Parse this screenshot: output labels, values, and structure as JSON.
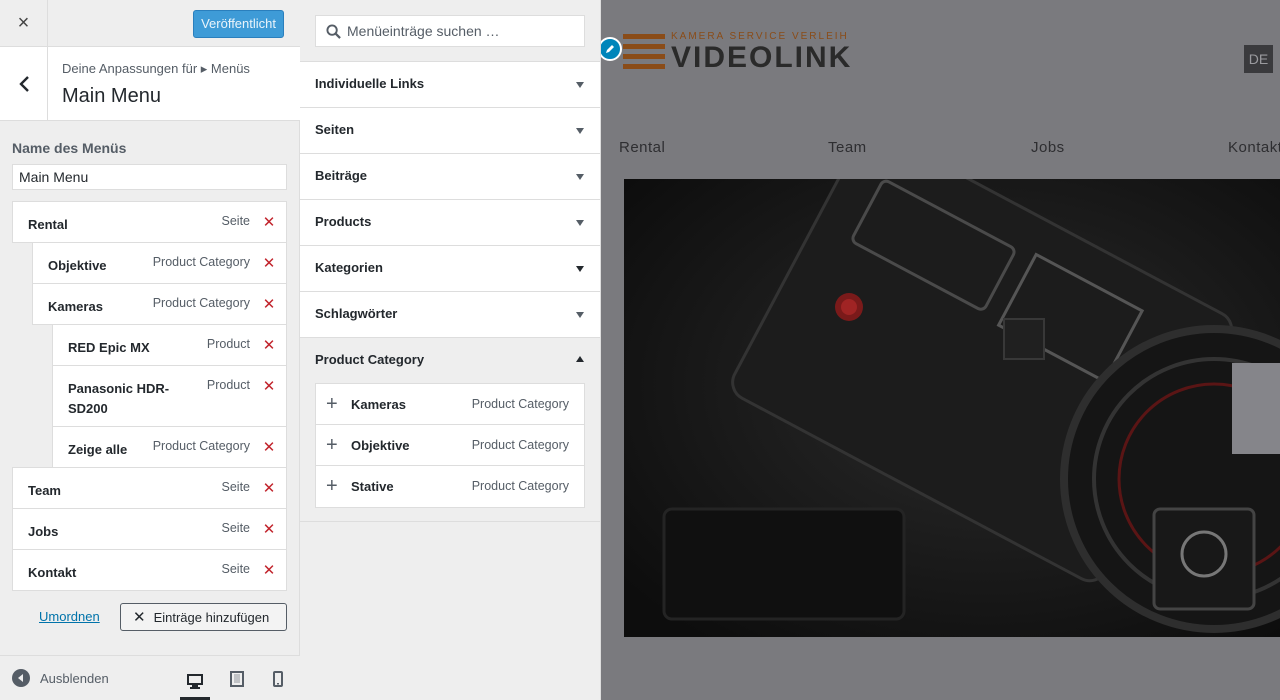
{
  "topbar": {
    "close_icon": "×",
    "publish_label": "Veröffentlicht",
    "publish_color": "#3e9bd7"
  },
  "section": {
    "crumb": "Deine Anpassungen für ▸ Menüs",
    "title": "Main Menu"
  },
  "menu_name": {
    "label": "Name des Menüs",
    "value": "Main Menu"
  },
  "menu_items": [
    {
      "title": "Rental",
      "type": "Seite"
    },
    {
      "title": "Objektive",
      "type": "Product Category"
    },
    {
      "title": "Kameras",
      "type": "Product Category"
    },
    {
      "title": "RED Epic MX",
      "type": "Product"
    },
    {
      "title": "Panasonic HDR-SD200",
      "type": "Product"
    },
    {
      "title": "Zeige alle",
      "type": "Product Category"
    },
    {
      "title": "Team",
      "type": "Seite"
    },
    {
      "title": "Jobs",
      "type": "Seite"
    },
    {
      "title": "Kontakt",
      "type": "Seite"
    }
  ],
  "actions": {
    "reorder_label": "Umordnen",
    "add_items_label": "Einträge hinzufügen"
  },
  "footer": {
    "collapse_label": "Ausblenden",
    "devices": [
      "desktop-icon",
      "tablet-icon",
      "mobile-icon"
    ],
    "active_device": "desktop"
  },
  "available": {
    "search_placeholder": "Menüeinträge suchen …",
    "sections": [
      {
        "label": "Individuelle Links",
        "open": false
      },
      {
        "label": "Seiten",
        "open": false
      },
      {
        "label": "Beiträge",
        "open": false
      },
      {
        "label": "Products",
        "open": false
      },
      {
        "label": "Kategorien",
        "open": false
      },
      {
        "label": "Schlagwörter",
        "open": false
      },
      {
        "label": "Product Category",
        "open": true
      }
    ],
    "category_items": [
      {
        "title": "Kameras",
        "type": "Product Category"
      },
      {
        "title": "Objektive",
        "type": "Product Category"
      },
      {
        "title": "Stative",
        "type": "Product Category"
      }
    ]
  },
  "preview": {
    "logo_tagline": "KAMERA SERVICE VERLEIH",
    "logo_word": "VIDEOLINK",
    "logo_color": "#b5651d",
    "lang": "DE",
    "nav": [
      "Rental",
      "Team",
      "Jobs",
      "Kontakt"
    ]
  },
  "colors": {
    "delete": "#c1242c",
    "link": "#0073aa"
  }
}
